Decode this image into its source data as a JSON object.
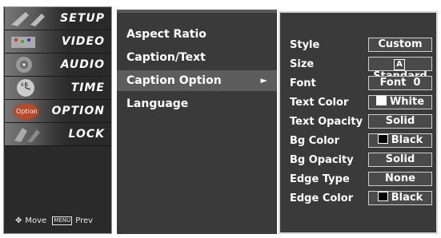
{
  "categories": [
    {
      "label": "SETUP",
      "icon": "setup-icon"
    },
    {
      "label": "VIDEO",
      "icon": "video-icon"
    },
    {
      "label": "AUDIO",
      "icon": "audio-icon"
    },
    {
      "label": "TIME",
      "icon": "time-icon"
    },
    {
      "label": "OPTION",
      "icon": "option-icon"
    },
    {
      "label": "LOCK",
      "icon": "lock-icon"
    }
  ],
  "help": {
    "move": "Move",
    "menu_key": "MENU",
    "prev": "Prev"
  },
  "submenu": [
    {
      "label": "Aspect Ratio"
    },
    {
      "label": "Caption/Text"
    },
    {
      "label": "Caption Option",
      "selected": true,
      "arrow": "►"
    },
    {
      "label": "Language"
    }
  ],
  "options": [
    {
      "key": "Style",
      "value": "Custom"
    },
    {
      "key": "Size",
      "value": "Standard",
      "prefix": "A"
    },
    {
      "key": "Font",
      "value": "Font  0"
    },
    {
      "key": "Text Color",
      "value": "White",
      "swatch": "#ffffff"
    },
    {
      "key": "Text Opacity",
      "value": "Solid"
    },
    {
      "key": "Bg Color",
      "value": "Black",
      "swatch": "#000000"
    },
    {
      "key": "Bg Opacity",
      "value": "Solid"
    },
    {
      "key": "Edge Type",
      "value": "None"
    },
    {
      "key": "Edge Color",
      "value": "Black",
      "swatch": "#000000"
    }
  ],
  "colors": {
    "panel": "#3a3a3a",
    "selected": "#5d5d5d",
    "border": "#d8d8d8"
  }
}
